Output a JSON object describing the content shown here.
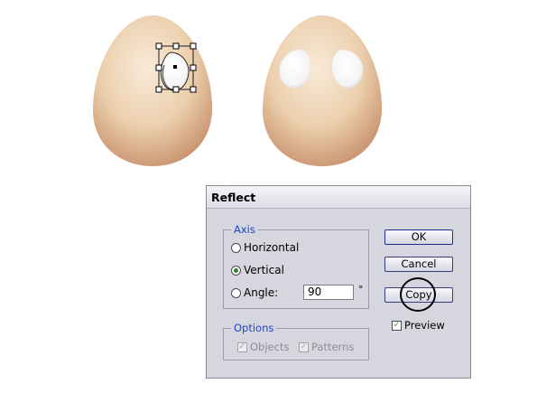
{
  "artwork": {
    "left_egg": {
      "state": "selected",
      "eye_count": 1
    },
    "right_egg": {
      "eye_count": 2
    },
    "colors": {
      "egg_light": "#f6e6d2",
      "egg_mid": "#e9c7a3",
      "egg_dark": "#c58f6d",
      "eye_white": "#ffffff"
    }
  },
  "dialog": {
    "title": "Reflect",
    "axis": {
      "label": "Axis",
      "horizontal_label": "Horizontal",
      "vertical_label": "Vertical",
      "angle_label": "Angle:",
      "angle_value": "90",
      "degree_symbol": "°",
      "selected": "Vertical"
    },
    "options": {
      "label": "Options",
      "objects_label": "Objects",
      "patterns_label": "Patterns",
      "objects_checked": true,
      "patterns_checked": true,
      "disabled": true
    },
    "buttons": {
      "ok": "OK",
      "cancel": "Cancel",
      "copy": "Copy"
    },
    "preview": {
      "label": "Preview",
      "checked": true
    },
    "colors": {
      "group_label": "#1c45c8",
      "dialog_bg": "#d6d6df",
      "check_mark": "#2a8a2a"
    }
  }
}
